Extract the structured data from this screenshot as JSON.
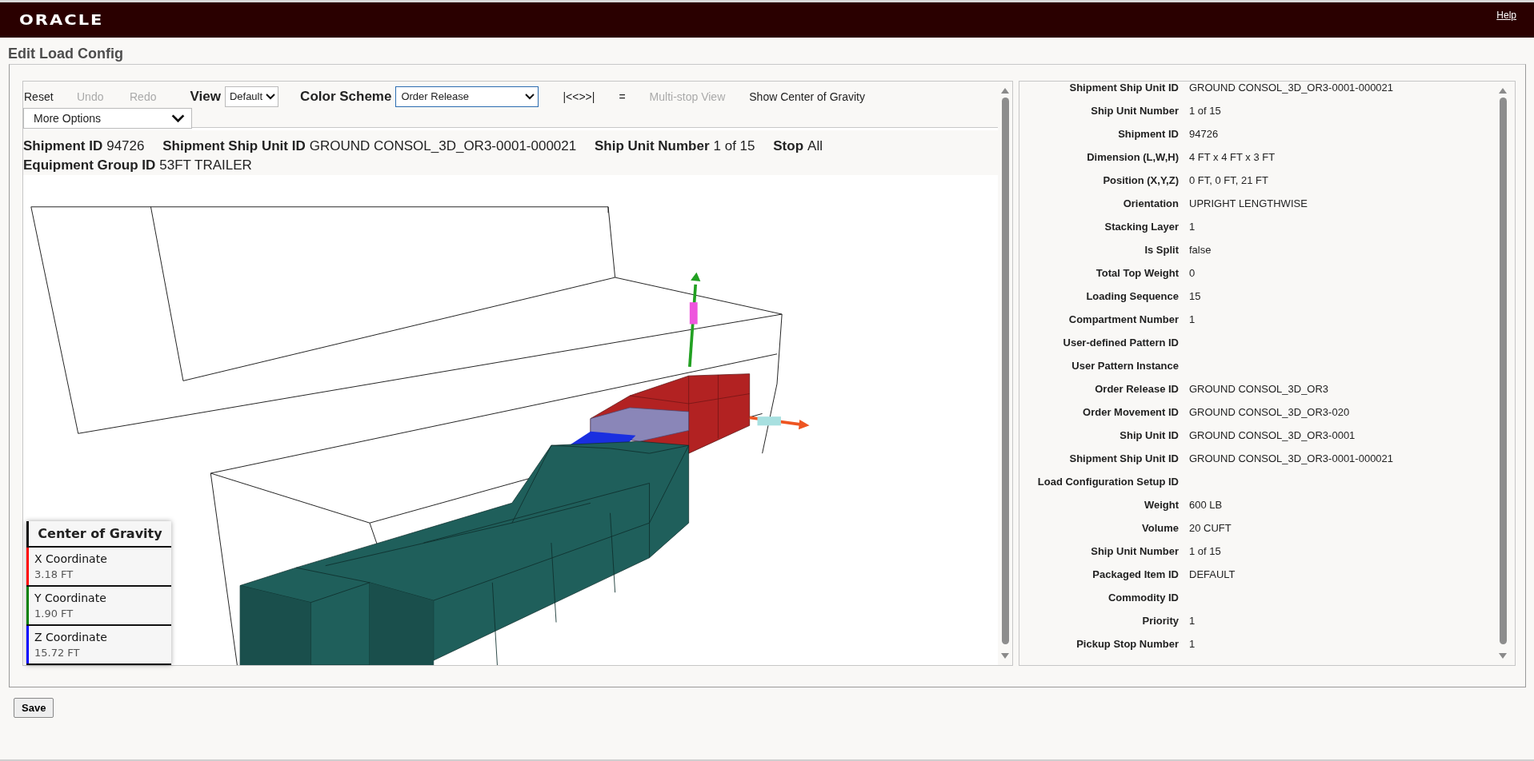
{
  "header": {
    "logo": "ORACLE",
    "help": "Help"
  },
  "page_title": "Edit Load Config",
  "toolbar": {
    "actions": [
      {
        "label": "Reset",
        "disabled": false
      },
      {
        "label": "Undo",
        "disabled": true
      },
      {
        "label": "Redo",
        "disabled": true
      }
    ],
    "view": {
      "label": "View",
      "value": "Default"
    },
    "color_scheme": {
      "label": "Color Scheme",
      "value": "Order Release"
    },
    "links": [
      {
        "label": "|<<>>|",
        "disabled": false
      },
      {
        "label": "=",
        "disabled": false
      },
      {
        "label": "Multi-stop View",
        "disabled": true
      },
      {
        "label": "Show Center of Gravity",
        "disabled": false
      }
    ],
    "more_options": "More Options"
  },
  "summary": [
    {
      "label": "Shipment ID",
      "value": "94726"
    },
    {
      "label": "Shipment Ship Unit ID",
      "value": "GROUND CONSOL_3D_OR3-0001-000021"
    },
    {
      "label": "Ship Unit Number",
      "value": "1 of 15"
    },
    {
      "label": "Stop",
      "value": "All"
    },
    {
      "label": "Equipment Group ID",
      "value": "53FT TRAILER"
    }
  ],
  "center_of_gravity": {
    "title": "Center of Gravity",
    "coordinates": [
      {
        "label": "X Coordinate",
        "value": "3.18 FT",
        "color": "#ff0000"
      },
      {
        "label": "Y Coordinate",
        "value": "1.90 FT",
        "color": "#008000"
      },
      {
        "label": "Z Coordinate",
        "value": "15.72 FT",
        "color": "#0000ff"
      }
    ]
  },
  "details": [
    {
      "label": "Shipment Ship Unit ID",
      "value": "GROUND CONSOL_3D_OR3-0001-000021"
    },
    {
      "label": "Ship Unit Number",
      "value": "1 of 15"
    },
    {
      "label": "Shipment ID",
      "value": "94726"
    },
    {
      "label": "Dimension (L,W,H)",
      "value": "4 FT x 4 FT x 3 FT"
    },
    {
      "label": "Position (X,Y,Z)",
      "value": "0 FT, 0 FT, 21 FT"
    },
    {
      "label": "Orientation",
      "value": "UPRIGHT LENGTHWISE"
    },
    {
      "label": "Stacking Layer",
      "value": "1"
    },
    {
      "label": "Is Split",
      "value": "false"
    },
    {
      "label": "Total Top Weight",
      "value": "0"
    },
    {
      "label": "Loading Sequence",
      "value": "15"
    },
    {
      "label": "Compartment Number",
      "value": "1"
    },
    {
      "label": "User-defined Pattern ID"
    },
    {
      "label": "User Pattern Instance"
    },
    {
      "label": "Order Release ID",
      "value": "GROUND CONSOL_3D_OR3"
    },
    {
      "label": "Order Movement ID",
      "value": "GROUND CONSOL_3D_OR3-020"
    },
    {
      "label": "Ship Unit ID",
      "value": "GROUND CONSOL_3D_OR3-0001"
    },
    {
      "label": "Shipment Ship Unit ID",
      "value": "GROUND CONSOL_3D_OR3-0001-000021"
    },
    {
      "label": "Load Configuration Setup ID"
    },
    {
      "label": "Weight",
      "value": "600 LB"
    },
    {
      "label": "Volume",
      "value": "20 CUFT"
    },
    {
      "label": "Ship Unit Number",
      "value": "1 of 15"
    },
    {
      "label": "Packaged Item ID",
      "value": "DEFAULT"
    },
    {
      "label": "Commodity ID"
    },
    {
      "label": "Priority",
      "value": "1"
    },
    {
      "label": "Pickup Stop Number",
      "value": "1"
    }
  ],
  "save_button": "Save"
}
